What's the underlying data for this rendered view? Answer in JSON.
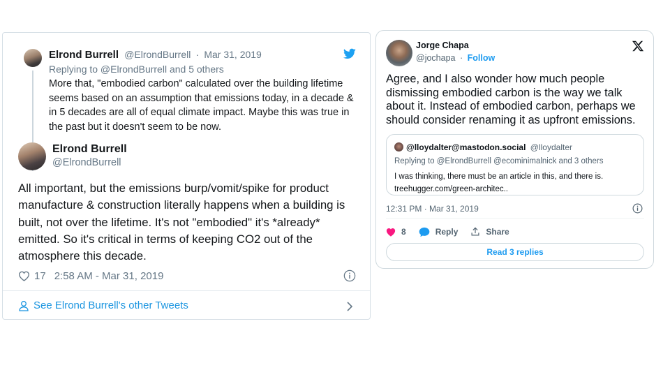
{
  "left_tweet": {
    "reply": {
      "author_name": "Elrond Burrell",
      "author_handle": "@ElrondBurrell",
      "date": "Mar 31, 2019",
      "replying_to": "Replying to @ElrondBurrell and 5 others",
      "text": "More that, \"embodied carbon\" calculated over the building lifetime seems based on an assumption that emissions today, in a decade & in 5 decades are all of equal climate impact. Maybe this was true in the past but it doesn't seem to be now."
    },
    "main": {
      "author_name": "Elrond Burrell",
      "author_handle": "@ElrondBurrell",
      "text": "All important, but the emissions burp/vomit/spike for product manufacture & construction literally happens when a building is built, not over the lifetime. It's not \"embodied\" it's *already* emitted. So it's critical in terms of keeping CO2 out of the atmosphere this decade.",
      "likes": "17",
      "timestamp": "2:58 AM - Mar 31, 2019"
    },
    "footer_link": "See Elrond Burrell's other Tweets",
    "colors": {
      "link": "#1b95e0",
      "muted": "#657786",
      "bird": "#1da1f2"
    },
    "icons": [
      "bird-icon",
      "heart-icon",
      "info-icon",
      "person-icon",
      "chevron-right-icon"
    ]
  },
  "right_tweet": {
    "author_name": "Jorge Chapa",
    "author_handle": "@jochapa",
    "follow_label": "Follow",
    "text": "Agree, and I also wonder how much people dismissing embodied carbon is the way we talk about it. Instead of embodied carbon, perhaps we should consider renaming it as upfront emissions.",
    "quote": {
      "author_name": "@lloydalter@mastodon.social",
      "author_handle": "@lloydalter",
      "replying_to": "Replying to @ElrondBurrell @ecominimalnick and 3 others",
      "text_line1": "I was thinking, there must be an article in this, and there is.",
      "text_line2": "treehugger.com/green-architec.."
    },
    "timestamp": "12:31 PM · Mar 31, 2019",
    "likes": "8",
    "reply_label": "Reply",
    "share_label": "Share",
    "read_replies_label": "Read 3 replies",
    "colors": {
      "link": "#1d9bf0",
      "heart": "#f91880",
      "muted": "#536471"
    },
    "icons": [
      "x-logo-icon",
      "heart-icon",
      "reply-bubble-icon",
      "share-icon",
      "info-icon"
    ]
  }
}
